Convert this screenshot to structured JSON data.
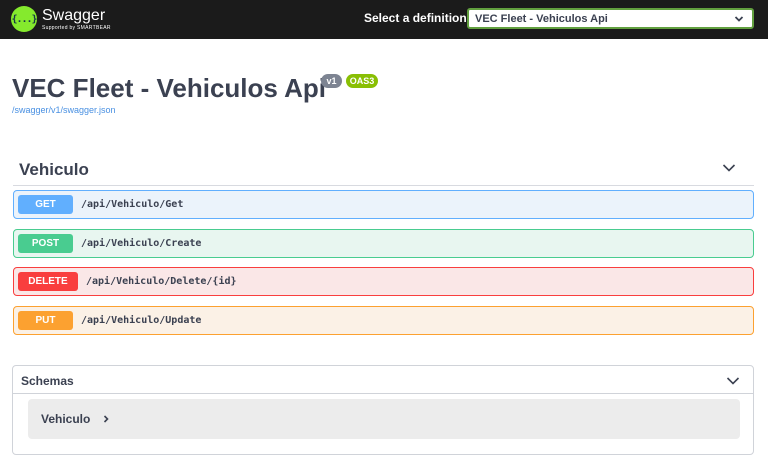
{
  "topbar": {
    "brand": "Swagger",
    "brand_sub": "Supported by SMARTBEAR",
    "logo_glyph": "{...}",
    "definition_label": "Select a definition",
    "definition_selected": "VEC Fleet - Vehiculos Api"
  },
  "info": {
    "title": "VEC Fleet - Vehiculos Api",
    "version_badge": "v1",
    "oas_badge": "OAS3",
    "spec_link": "/swagger/v1/swagger.json"
  },
  "tag": {
    "name": "Vehiculo",
    "operations": [
      {
        "method": "GET",
        "path": "/api/Vehiculo/Get",
        "color": "#61affe"
      },
      {
        "method": "POST",
        "path": "/api/Vehiculo/Create",
        "color": "#49cc90"
      },
      {
        "method": "DELETE",
        "path": "/api/Vehiculo/Delete/{id}",
        "color": "#f93e3e"
      },
      {
        "method": "PUT",
        "path": "/api/Vehiculo/Update",
        "color": "#fca130"
      }
    ]
  },
  "schemas": {
    "title": "Schemas",
    "models": [
      {
        "name": "Vehiculo"
      }
    ]
  },
  "colors": {
    "topbar_bg": "#1b1b1b",
    "brand_green": "#85ea2d",
    "select_border": "#62a03f",
    "badge_gray": "#7d8492",
    "badge_green": "#89bf04",
    "link_blue": "#4990e2"
  },
  "icons": {
    "logo": "swagger-logo-icon",
    "definition_dropdown": "chevron-down-icon",
    "tag_toggle": "chevron-down-icon",
    "schemas_toggle": "chevron-down-icon",
    "model_expand": "chevron-right-icon"
  }
}
